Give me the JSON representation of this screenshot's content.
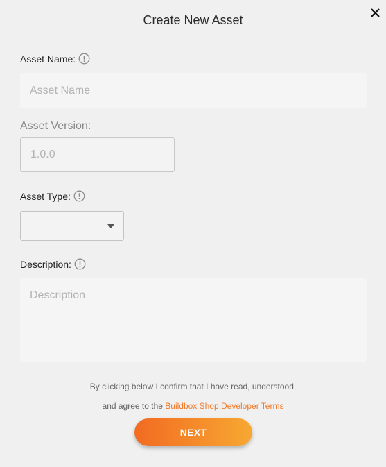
{
  "dialog": {
    "title": "Create New Asset",
    "close_icon": "close-icon"
  },
  "fields": {
    "asset_name": {
      "label": "Asset Name:",
      "placeholder": "Asset Name",
      "value": ""
    },
    "asset_version": {
      "label": "Asset Version:",
      "placeholder": "1.0.0",
      "value": ""
    },
    "asset_type": {
      "label": "Asset Type:",
      "selected": ""
    },
    "description": {
      "label": "Description:",
      "placeholder": "Description",
      "value": ""
    }
  },
  "info_icon": "info-circle-icon",
  "terms": {
    "line1": "By clicking below I confirm that I have read, understood,",
    "line2_prefix": "and agree to the ",
    "link_text": "Buildbox Shop Developer Terms"
  },
  "next_button": "NEXT",
  "colors": {
    "accent": "#f07a28",
    "button_gradient_start": "#f26b21",
    "button_gradient_end": "#f7a832",
    "background": "#f0f0f0"
  }
}
